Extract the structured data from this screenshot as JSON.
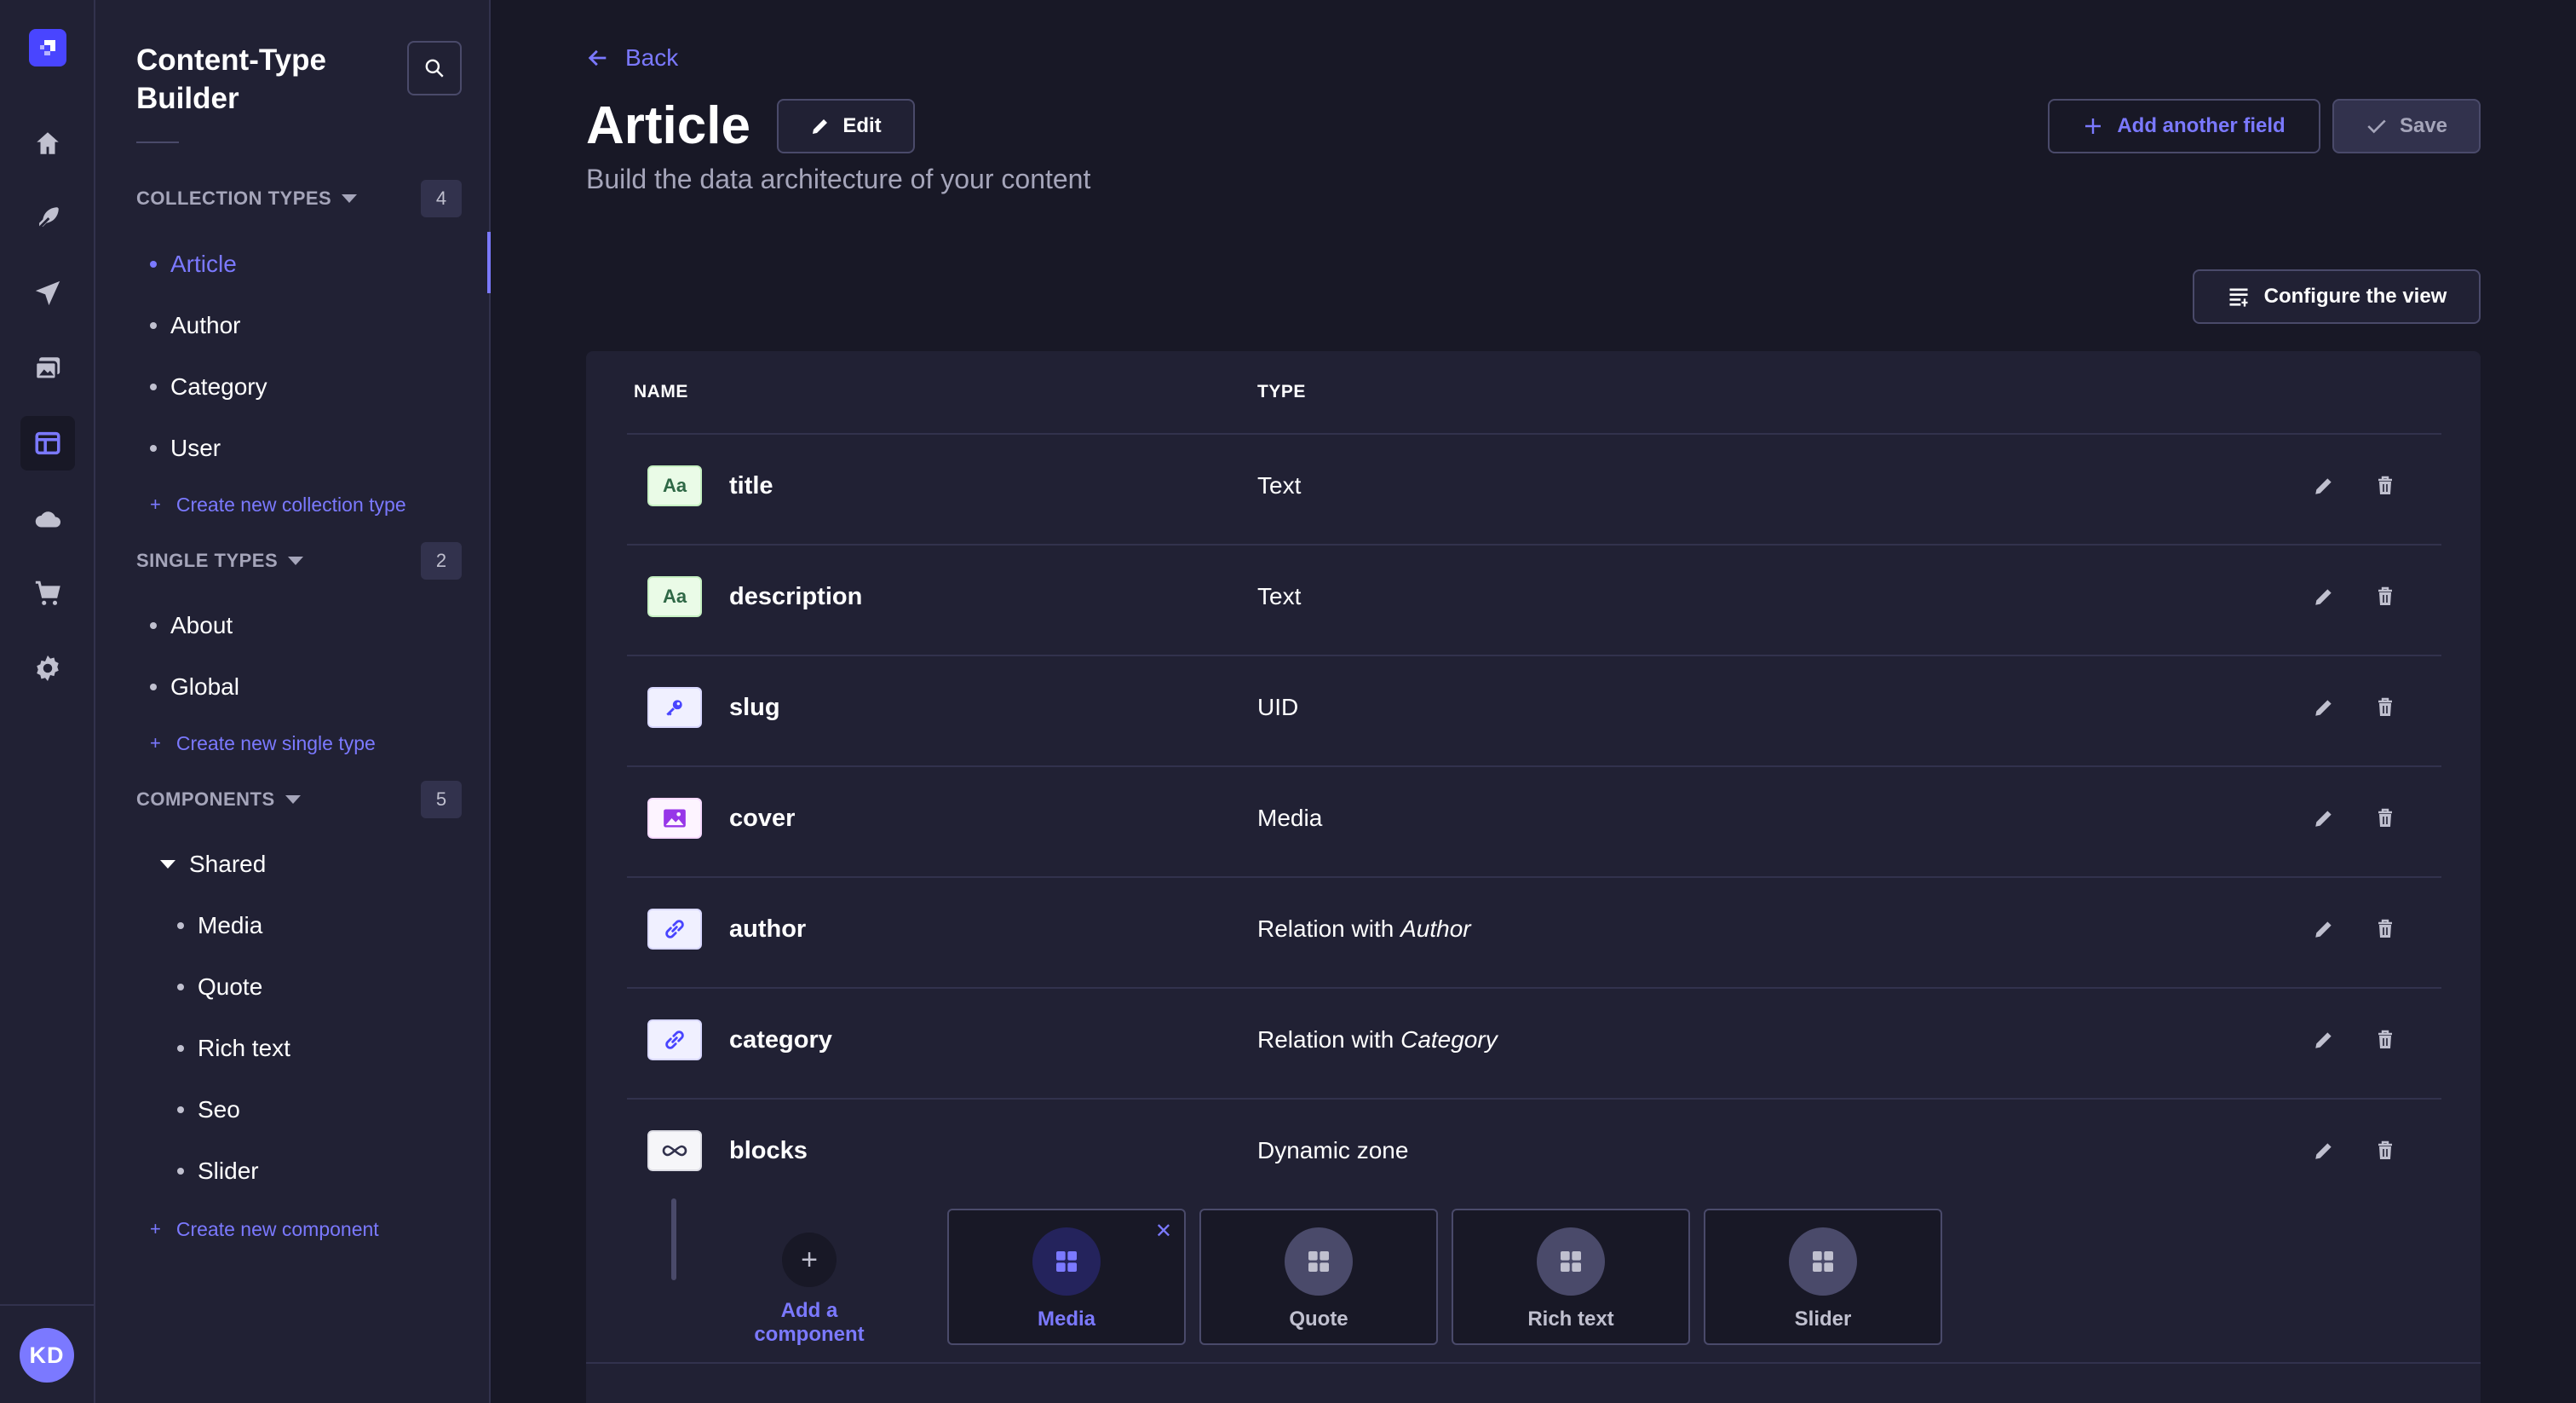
{
  "colors": {
    "accent": "#7b79ff",
    "brand": "#4945ff",
    "bg": "#181826",
    "panel": "#212134"
  },
  "rail": {
    "items": [
      {
        "name": "home-icon",
        "active": false
      },
      {
        "name": "feather-icon",
        "active": false
      },
      {
        "name": "paper-plane-icon",
        "active": false
      },
      {
        "name": "media-library-icon",
        "active": false
      },
      {
        "name": "layout-icon",
        "active": true
      },
      {
        "name": "cloud-icon",
        "active": false
      },
      {
        "name": "cart-icon",
        "active": false
      },
      {
        "name": "gear-icon",
        "active": false
      }
    ],
    "avatar_initials": "KD"
  },
  "subnav": {
    "title": "Content-Type Builder",
    "collection_types": {
      "label": "COLLECTION TYPES",
      "count": "4",
      "items": [
        "Article",
        "Author",
        "Category",
        "User"
      ],
      "active": "Article",
      "create_label": "Create new collection type"
    },
    "single_types": {
      "label": "SINGLE TYPES",
      "count": "2",
      "items": [
        "About",
        "Global"
      ],
      "create_label": "Create new single type"
    },
    "components": {
      "label": "COMPONENTS",
      "count": "5",
      "group": "Shared",
      "items": [
        "Media",
        "Quote",
        "Rich text",
        "Seo",
        "Slider"
      ],
      "create_label": "Create new component"
    }
  },
  "header": {
    "back_label": "Back",
    "title": "Article",
    "edit_label": "Edit",
    "subtitle": "Build the data architecture of your content",
    "add_field_label": "Add another field",
    "save_label": "Save",
    "configure_label": "Configure the view"
  },
  "table": {
    "columns": {
      "name": "NAME",
      "type": "TYPE"
    },
    "rows": [
      {
        "name": "title",
        "type": "Text",
        "type_target": "",
        "icon": "text-icon"
      },
      {
        "name": "description",
        "type": "Text",
        "type_target": "",
        "icon": "text-icon"
      },
      {
        "name": "slug",
        "type": "UID",
        "type_target": "",
        "icon": "key-icon"
      },
      {
        "name": "cover",
        "type": "Media",
        "type_target": "",
        "icon": "image-icon"
      },
      {
        "name": "author",
        "type": "Relation with ",
        "type_target": "Author",
        "icon": "link-icon"
      },
      {
        "name": "category",
        "type": "Relation with ",
        "type_target": "Category",
        "icon": "link-icon"
      },
      {
        "name": "blocks",
        "type": "Dynamic zone",
        "type_target": "",
        "icon": "infinity-icon"
      }
    ],
    "dynamic_zone": {
      "add_label": "Add a component",
      "components": [
        "Media",
        "Quote",
        "Rich text",
        "Slider"
      ],
      "active": "Media"
    }
  }
}
